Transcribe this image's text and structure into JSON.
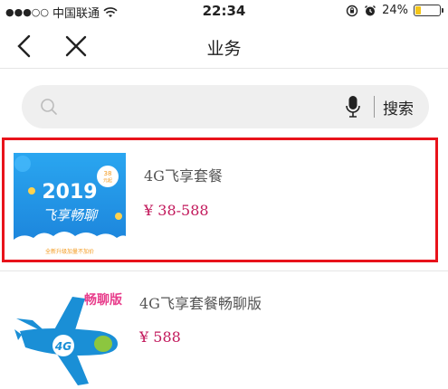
{
  "status_bar": {
    "signal_dots": "●●●○○",
    "carrier": "中国联通",
    "time": "22:34",
    "battery_percent": "24%",
    "battery_level": 0.24,
    "icons": [
      "signal-icon",
      "wifi-icon",
      "lock-rotation-icon",
      "alarm-icon",
      "battery-icon"
    ]
  },
  "nav": {
    "title": "业务",
    "back_icon": "chevron-left-icon",
    "close_icon": "close-icon"
  },
  "search": {
    "placeholder": "",
    "value": "",
    "button_label": "搜索",
    "icons": [
      "search-icon",
      "microphone-icon"
    ]
  },
  "products": [
    {
      "title": "4G飞享套餐",
      "price": "¥ 38-588",
      "image": {
        "year": "2019",
        "slogan": "飞享畅聊",
        "badge_top": "38",
        "badge_bottom": "元起",
        "footer": "全新升级加量不加价"
      },
      "highlighted": true
    },
    {
      "title": "4G飞享套餐畅聊版",
      "price": "¥ 588",
      "image": {
        "tag": "畅聊版",
        "plane_label": "4G"
      },
      "highlighted": false
    }
  ],
  "colors": {
    "highlight_border": "#e8131b",
    "price": "#c2185b",
    "search_bg": "#efefef",
    "plane_blue": "#1a8fd6",
    "plane_green": "#8cc63f"
  }
}
